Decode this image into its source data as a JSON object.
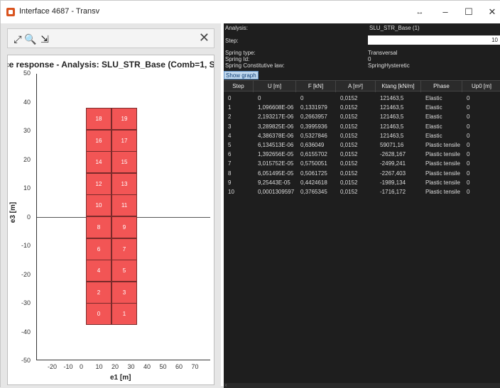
{
  "window": {
    "title": "Interface 4687 - Transv",
    "controls": {
      "minimize": "–",
      "maximize": "☐",
      "close": "✕"
    }
  },
  "left": {
    "toolbar": {
      "fit_icon": "fit-view-icon",
      "zoom_icon": "zoom-icon",
      "export_icon": "export-icon",
      "close_icon": "close-icon"
    },
    "plot_title": "ce response - Analysis: SLU_STR_Base (Comb=1, St",
    "ylabel": "e3 [m]",
    "xlabel": "e1 [m]",
    "yticks": [
      "50",
      "40",
      "30",
      "20",
      "10",
      "0",
      "-10",
      "-20",
      "-30",
      "-40",
      "-50"
    ],
    "xticks": [
      "-20",
      "-10",
      "0",
      "10",
      "20",
      "30",
      "40",
      "50",
      "60",
      "70"
    ],
    "fibers": [
      [
        "18",
        "19"
      ],
      [
        "16",
        "17"
      ],
      [
        "14",
        "15"
      ],
      [
        "12",
        "13"
      ],
      [
        "10",
        "11"
      ],
      [
        "8",
        "9"
      ],
      [
        "6",
        "7"
      ],
      [
        "4",
        "5"
      ],
      [
        "2",
        "3"
      ],
      [
        "0",
        "1"
      ]
    ]
  },
  "right": {
    "analysis_label": "Analysis:",
    "analysis_value": "SLU_STR_Base (1)",
    "step_label": "Step:",
    "step_value": "10",
    "spring_type_label": "Spring type:",
    "spring_type_value": "Transversal",
    "spring_id_label": "Spring Id:",
    "spring_id_value": "0",
    "law_label": "Spring Constitutive law:",
    "law_value": "SpringHysteretic",
    "show_graph": "Show graph",
    "columns": [
      "Step",
      "U [m]",
      "F [kN]",
      "A [m²]",
      "Ktang [kN/m]",
      "Phase",
      "Up0 [m]"
    ],
    "rows": [
      [
        "0",
        "0",
        "0",
        "0,0152",
        "121463,5",
        "Elastic",
        "0"
      ],
      [
        "1",
        "1,096608E-06",
        "0,1331979",
        "0,0152",
        "121463,5",
        "Elastic",
        "0"
      ],
      [
        "2",
        "2,193217E-06",
        "0,2663957",
        "0,0152",
        "121463,5",
        "Elastic",
        "0"
      ],
      [
        "3",
        "3,289825E-06",
        "0,3995936",
        "0,0152",
        "121463,5",
        "Elastic",
        "0"
      ],
      [
        "4",
        "4,386378E-06",
        "0,5327846",
        "0,0152",
        "121463,5",
        "Elastic",
        "0"
      ],
      [
        "5",
        "6,134513E-06",
        "0,636049",
        "0,0152",
        "59071,16",
        "Plastic tensile",
        "0"
      ],
      [
        "6",
        "1,392656E-05",
        "0,6155702",
        "0,0152",
        "-2628,167",
        "Plastic tensile",
        "0"
      ],
      [
        "7",
        "3,015752E-05",
        "0,5750051",
        "0,0152",
        "-2499,241",
        "Plastic tensile",
        "0"
      ],
      [
        "8",
        "6,051495E-05",
        "0,5061725",
        "0,0152",
        "-2267,403",
        "Plastic tensile",
        "0"
      ],
      [
        "9",
        "9,25443E-05",
        "0,4424618",
        "0,0152",
        "-1989,134",
        "Plastic tensile",
        "0"
      ],
      [
        "10",
        "0,0001309597",
        "0,3765345",
        "0,0152",
        "-1716,172",
        "Plastic tensile",
        "0"
      ]
    ]
  },
  "colors": {
    "fiber": "#f25555",
    "panel_bg": "#1e1e1e",
    "show_graph_bg": "#c0d8ee"
  }
}
